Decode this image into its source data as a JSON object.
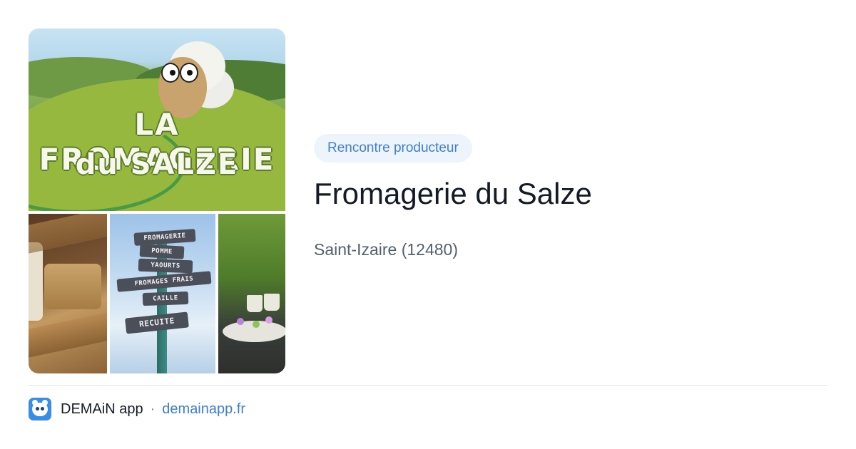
{
  "card": {
    "image": {
      "title_line_1": "LA FROMAGERIE",
      "title_line_2": "du SALZE",
      "signpost": [
        "FROMAGERIE",
        "POMME",
        "YAOURTS",
        "FROMAGES FRAIS",
        "CAILLE",
        "RECUITE"
      ]
    },
    "badge": "Rencontre producteur",
    "title": "Fromagerie du Salze",
    "subtitle": "Saint-Izaire (12480)"
  },
  "footer": {
    "app_name": "DEMAiN app",
    "separator": "·",
    "link": "demainapp.fr",
    "icon": "demain-app-icon"
  },
  "colors": {
    "accent": "#3e7fcf",
    "badge_bg": "#eef4fc",
    "title": "#141a26",
    "subtitle": "#55606f",
    "divider": "#dde3ea"
  }
}
